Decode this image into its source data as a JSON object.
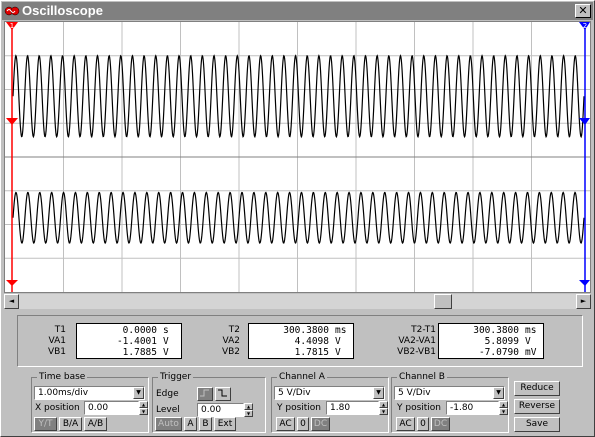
{
  "window": {
    "title": "Oscilloscope",
    "close_label": "✕"
  },
  "display": {
    "background": "#ffffff",
    "grid_color": "#808080",
    "trace_color": "#000000",
    "cursor1_color": "#ff0000",
    "cursor2_color": "#0000ff",
    "cursor1_label": "1",
    "cursor2_label": "2",
    "channel_a": {
      "cycles_visible": 49,
      "level_divisions": 1.8,
      "amplitude_divisions": 1.2,
      "name": "A"
    },
    "channel_b": {
      "cycles_visible": 48,
      "level_divisions": -1.8,
      "amplitude_divisions": 0.75,
      "name": "B"
    },
    "grid_divisions": {
      "x": 10,
      "y": 8
    }
  },
  "scrollbar": {
    "left_arrow": "◄",
    "right_arrow": "►",
    "position_fraction": 0.77
  },
  "readout": {
    "col1": {
      "labels": [
        "T1",
        "VA1",
        "VB1"
      ],
      "rows": [
        {
          "value": "0.0000",
          "unit": "s"
        },
        {
          "value": "-1.4001",
          "unit": "V"
        },
        {
          "value": "1.7885",
          "unit": "V"
        }
      ]
    },
    "col2": {
      "labels": [
        "T2",
        "VA2",
        "VB2"
      ],
      "rows": [
        {
          "value": "300.3800",
          "unit": "ms"
        },
        {
          "value": "4.4098",
          "unit": "V"
        },
        {
          "value": "1.7815",
          "unit": "V"
        }
      ]
    },
    "col3": {
      "labels": [
        "T2-T1",
        "VA2-VA1",
        "VB2-VB1"
      ],
      "rows": [
        {
          "value": "300.3800",
          "unit": "ms"
        },
        {
          "value": "5.8099",
          "unit": "V"
        },
        {
          "value": "-7.0790",
          "unit": "mV"
        }
      ]
    }
  },
  "timebase": {
    "legend": "Time base",
    "scale": "1.00ms/div",
    "x_position_label": "X position",
    "x_position": "0.00",
    "buttons": [
      "Y/T",
      "B/A",
      "A/B"
    ]
  },
  "trigger": {
    "legend": "Trigger",
    "edge_label": "Edge",
    "level_label": "Level",
    "level": "0.00",
    "buttons": [
      "Auto",
      "A",
      "B",
      "Ext"
    ]
  },
  "channel_a": {
    "legend": "Channel A",
    "scale": "5 V/Div",
    "y_position_label": "Y position",
    "y_position": "1.80",
    "buttons": [
      "AC",
      "0",
      "DC"
    ]
  },
  "channel_b": {
    "legend": "Channel B",
    "scale": "5 V/Div",
    "y_position_label": "Y position",
    "y_position": "-1.80",
    "buttons": [
      "AC",
      "0",
      "DC"
    ]
  },
  "side_buttons": [
    "Reduce",
    "Reverse",
    "Save"
  ]
}
